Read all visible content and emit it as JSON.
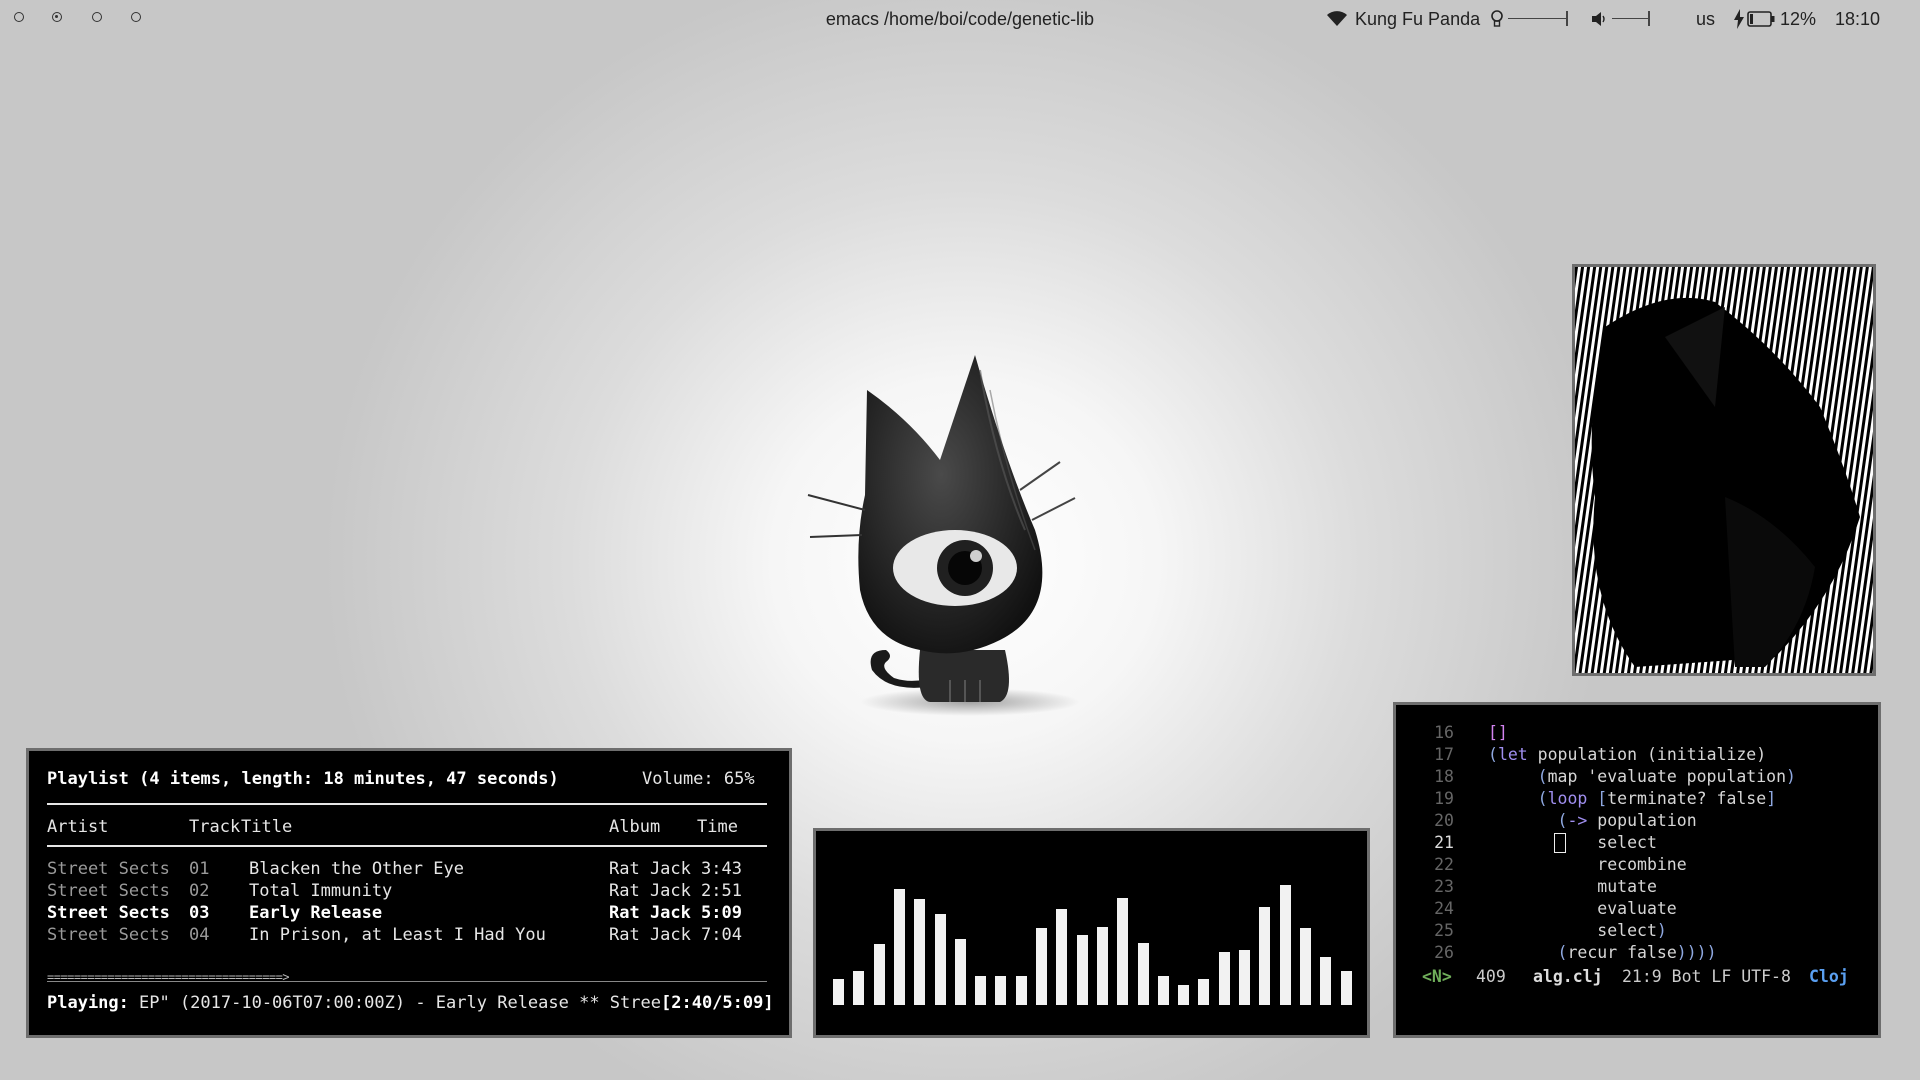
{
  "topbar": {
    "workspaces": [
      "workspace-1",
      "workspace-2",
      "workspace-3",
      "workspace-4"
    ],
    "window_title": "emacs /home/boi/code/genetic-lib",
    "wifi_name": "Kung Fu Panda",
    "keyboard_layout": "us",
    "battery": "12%",
    "clock": "18:10",
    "icons": [
      "wifi-icon",
      "brightness-icon",
      "volume-icon",
      "charging-icon",
      "battery-icon"
    ]
  },
  "playlist": {
    "header": "Playlist (4 items, length: 18 minutes, 47 seconds)",
    "volume": "Volume: 65%",
    "columns": {
      "artist": "Artist",
      "track": "Track",
      "title": "Title",
      "album": "Album",
      "time": "Time"
    },
    "rows": [
      {
        "artist": "Street Sects",
        "track": "01",
        "title": "Blacken the Other Eye",
        "album": "Rat Jack",
        "time": "3:43"
      },
      {
        "artist": "Street Sects",
        "track": "02",
        "title": "Total Immunity",
        "album": "Rat Jack",
        "time": "2:51"
      },
      {
        "artist": "Street Sects",
        "track": "03",
        "title": "Early Release",
        "album": "Rat Jack",
        "time": "5:09"
      },
      {
        "artist": "Street Sects",
        "track": "04",
        "title": "In Prison, at Least I Had You",
        "album": "Rat Jack",
        "time": "7:04"
      }
    ],
    "progress_bar": "===================================>",
    "playing_label": "Playing:",
    "playing_text": "EP\" (2017-10-06T07:00:00Z) - Early Release ** Stree",
    "playing_time": "[2:40/5:09]",
    "progress_fraction": 0.518
  },
  "visualizer": {
    "levels": [
      0.22,
      0.28,
      0.51,
      0.97,
      0.88,
      0.76,
      0.55,
      0.24,
      0.24,
      0.24,
      0.64,
      0.8,
      0.58,
      0.65,
      0.89,
      0.52,
      0.24,
      0.17,
      0.22,
      0.44,
      0.46,
      0.82,
      1.0,
      0.64,
      0.4,
      0.28
    ]
  },
  "emacs": {
    "lines": [
      {
        "n": "16",
        "tokens": [
          {
            "t": "[]",
            "c": "brk"
          }
        ]
      },
      {
        "n": "17",
        "tokens": [
          {
            "t": "(",
            "c": "par"
          },
          {
            "t": "let",
            "c": "kw"
          },
          {
            "t": " population ",
            "c": ""
          },
          {
            "t": "(initialize)",
            "c": ""
          }
        ]
      },
      {
        "n": "18",
        "tokens": [
          {
            "t": "     (",
            "c": "par"
          },
          {
            "t": "map 'evaluate population",
            "c": ""
          },
          {
            "t": ")",
            "c": "par"
          }
        ]
      },
      {
        "n": "19",
        "tokens": [
          {
            "t": "     (",
            "c": "par"
          },
          {
            "t": "loop",
            "c": "kw"
          },
          {
            "t": " [",
            "c": "par"
          },
          {
            "t": "terminate? false",
            "c": ""
          },
          {
            "t": "]",
            "c": "par"
          }
        ]
      },
      {
        "n": "20",
        "tokens": [
          {
            "t": "       (",
            "c": "par"
          },
          {
            "t": "->",
            "c": "kw"
          },
          {
            "t": " population",
            "c": ""
          }
        ]
      },
      {
        "n": "21",
        "tokens": [
          {
            "t": "           select",
            "c": ""
          }
        ]
      },
      {
        "n": "22",
        "tokens": [
          {
            "t": "           recombine",
            "c": ""
          }
        ]
      },
      {
        "n": "23",
        "tokens": [
          {
            "t": "           mutate",
            "c": ""
          }
        ]
      },
      {
        "n": "24",
        "tokens": [
          {
            "t": "           evaluate",
            "c": ""
          }
        ]
      },
      {
        "n": "25",
        "tokens": [
          {
            "t": "           select",
            "c": ""
          },
          {
            "t": ")",
            "c": "par"
          }
        ]
      },
      {
        "n": "26",
        "tokens": [
          {
            "t": "       (",
            "c": "par"
          },
          {
            "t": "recur false",
            "c": ""
          },
          {
            "t": "))))",
            "c": "par"
          }
        ]
      }
    ],
    "current_line": "21",
    "modeline": {
      "state": "<N>",
      "size": "409",
      "file": "alg.clj",
      "position": "21:9 Bot LF UTF-8",
      "mode": "Cloj"
    }
  },
  "colors": {
    "keyword": "#a08ff0",
    "bracket": "#d383f0",
    "paren": "#8fa8e0",
    "evil_state": "#6fae5a",
    "major_mode": "#5a9ff0"
  }
}
